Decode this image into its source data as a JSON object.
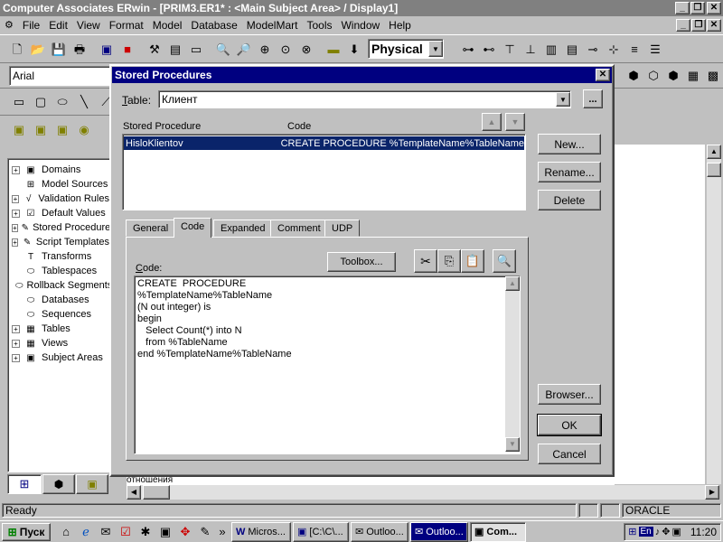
{
  "app": {
    "title": "Computer Associates ERwin - [PRIM3.ER1* : <Main Subject Area> / Display1]"
  },
  "menu": [
    "File",
    "Edit",
    "View",
    "Format",
    "Model",
    "Database",
    "ModelMart",
    "Tools",
    "Window",
    "Help"
  ],
  "toolbar": {
    "view_mode": "Physical",
    "font_name": "Arial"
  },
  "tree": {
    "items": [
      {
        "label": "Domains",
        "expand": true,
        "icon": "domains-icon"
      },
      {
        "label": "Model Sources",
        "expand": false,
        "icon": "model-sources-icon"
      },
      {
        "label": "Validation Rules",
        "expand": true,
        "icon": "validation-rules-icon"
      },
      {
        "label": "Default Values",
        "expand": true,
        "icon": "default-values-icon"
      },
      {
        "label": "Stored Procedures",
        "expand": true,
        "icon": "stored-procedures-icon"
      },
      {
        "label": "Script Templates",
        "expand": true,
        "icon": "script-templates-icon"
      },
      {
        "label": "Transforms",
        "expand": false,
        "icon": "transforms-icon"
      },
      {
        "label": "Tablespaces",
        "expand": false,
        "icon": "tablespaces-icon"
      },
      {
        "label": "Rollback Segments",
        "expand": false,
        "icon": "rollback-segments-icon"
      },
      {
        "label": "Databases",
        "expand": false,
        "icon": "databases-icon"
      },
      {
        "label": "Sequences",
        "expand": false,
        "icon": "sequences-icon"
      },
      {
        "label": "Tables",
        "expand": true,
        "icon": "tables-icon"
      },
      {
        "label": "Views",
        "expand": true,
        "icon": "views-icon"
      },
      {
        "label": "Subject Areas",
        "expand": true,
        "icon": "subject-areas-icon"
      }
    ]
  },
  "dialog": {
    "title": "Stored Procedures",
    "table_label": "Table:",
    "table_value": "Клиент",
    "browse_label": "...",
    "col_sp": "Stored Procedure",
    "col_code": "Code",
    "procedures": [
      {
        "name": "HisloKlientov",
        "code": "CREATE  PROCEDURE %TemplateName%TableName"
      }
    ],
    "buttons": {
      "new": "New...",
      "rename": "Rename...",
      "delete": "Delete",
      "browser": "Browser...",
      "ok": "OK",
      "cancel": "Cancel",
      "toolbox": "Toolbox..."
    },
    "tabs": [
      "General",
      "Code",
      "Expanded",
      "Comment",
      "UDP"
    ],
    "active_tab": "Code",
    "code_label": "Code:",
    "code_text": "CREATE  PROCEDURE\n%TemplateName%TableName\n(N out integer) is\nbegin\n   Select Count(*) into N\n   from %TableName\nend %TemplateName%TableName"
  },
  "canvas": {
    "partial_text": "отношения"
  },
  "status": {
    "ready": "Ready",
    "db": "ORACLE"
  },
  "taskbar": {
    "start": "Пуск",
    "tasks": [
      "Micros...",
      "[C:\\C\\...",
      "Outloo...",
      "Outloo...",
      "Com..."
    ],
    "lang": "En",
    "clock": "11:20"
  },
  "colors": {
    "title_inactive": "#808080",
    "title_active": "#000080",
    "selection": "#0a246a"
  }
}
